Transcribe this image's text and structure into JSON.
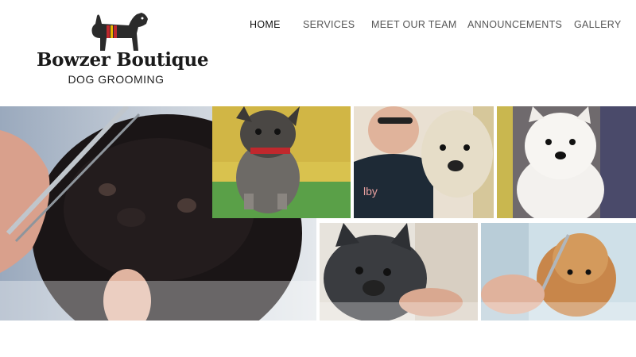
{
  "brand": {
    "name": "Bowzer Boutique",
    "tagline": "DOG GROOMING",
    "logo_icon": "dog-silhouette-icon"
  },
  "nav": {
    "items": [
      {
        "label": "HOME",
        "active": true
      },
      {
        "label": "SERVICES",
        "active": false
      },
      {
        "label": "MEET OUR TEAM",
        "active": false
      },
      {
        "label": "ANNOUNCEMENTS",
        "active": false
      },
      {
        "label": "GALLERY",
        "active": false
      }
    ]
  },
  "gallery": {
    "photos": [
      {
        "name": "black-dog-grooming-photo"
      },
      {
        "name": "yorkie-photo"
      },
      {
        "name": "groomer-with-terrier-photo"
      },
      {
        "name": "white-westie-photo"
      },
      {
        "name": "french-bulldog-photo"
      },
      {
        "name": "poodle-grooming-photo"
      }
    ]
  },
  "colors": {
    "logo_collar_red": "#c0282d",
    "logo_collar_yellow": "#e8b400",
    "logo_dog": "#2b2b2b",
    "nav_text": "#555555",
    "nav_active": "#111111"
  }
}
